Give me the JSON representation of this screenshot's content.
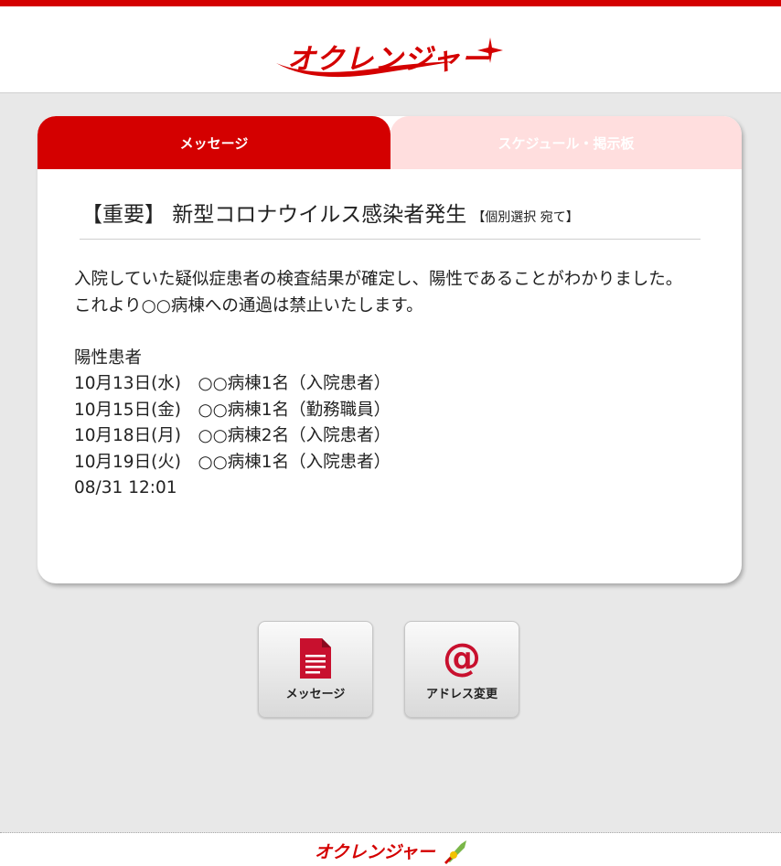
{
  "brand": {
    "logo_text": "オクレンジャー",
    "accent": "#d40000"
  },
  "tabs": [
    {
      "label": "メッセージ",
      "active": true
    },
    {
      "label": "スケジュール・掲示板",
      "active": false
    }
  ],
  "message": {
    "title": "【重要】 新型コロナウイルス感染者発生",
    "recipient": "【個別選択 宛て】",
    "body_lines": [
      "入院していた疑似症患者の検査結果が確定し、陽性であることがわかりました。",
      "これより○○病棟への通過は禁止いたします。",
      "",
      "陽性患者",
      "10月13日(水)　○○病棟1名（入院患者）",
      "10月15日(金)　○○病棟1名（勤務職員）",
      "10月18日(月)　○○病棟2名（入院患者）",
      "10月19日(火)　○○病棟1名（入院患者）"
    ],
    "timestamp": "08/31 12:01"
  },
  "buttons": {
    "message": {
      "label": "メッセージ",
      "icon": "document-icon"
    },
    "address": {
      "label": "アドレス変更",
      "icon": "at-sign-icon"
    }
  },
  "footer": {
    "logo_text": "オクレンジャー"
  }
}
